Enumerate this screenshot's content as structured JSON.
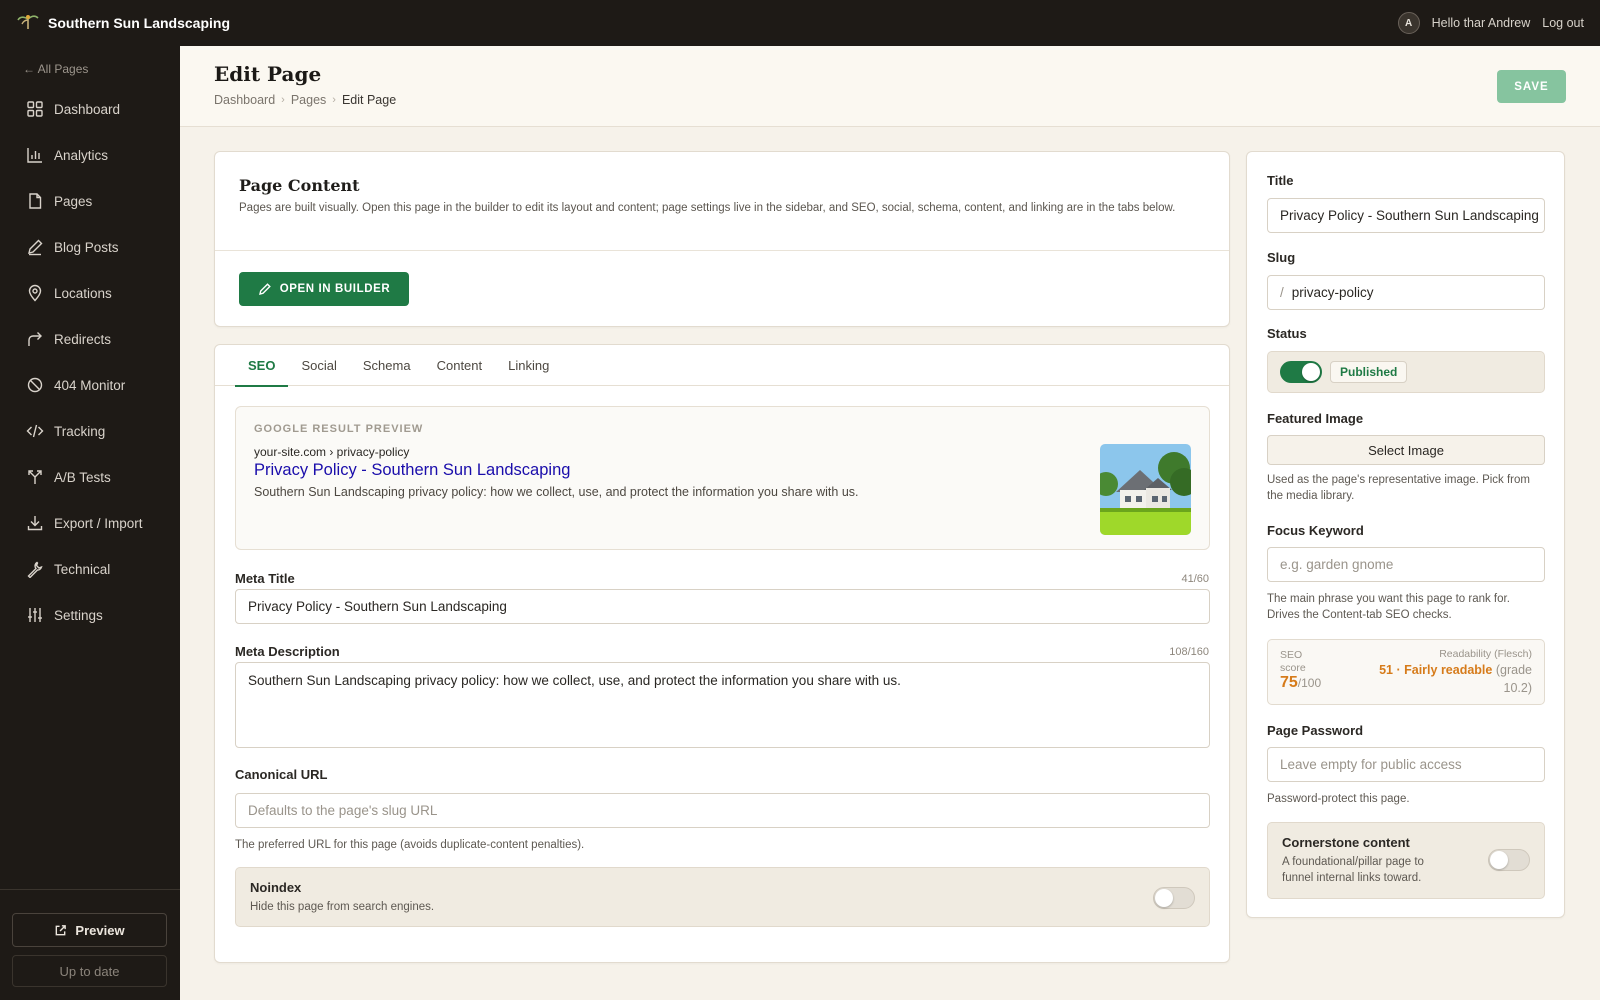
{
  "app": {
    "brand": "Southern Sun Landscaping"
  },
  "user": {
    "initial": "A",
    "greeting": "Hello thar Andrew",
    "logout": "Log out"
  },
  "sidebar": {
    "back": "← All Pages",
    "items": [
      {
        "label": "Dashboard",
        "icon": "grid-icon"
      },
      {
        "label": "Analytics",
        "icon": "bar-chart-icon"
      },
      {
        "label": "Pages",
        "icon": "file-icon"
      },
      {
        "label": "Blog Posts",
        "icon": "pen-icon"
      },
      {
        "label": "Locations",
        "icon": "map-pin-icon"
      },
      {
        "label": "Redirects",
        "icon": "redirect-arrow-icon"
      },
      {
        "label": "404 Monitor",
        "icon": "ban-icon"
      },
      {
        "label": "Tracking",
        "icon": "code-icon"
      },
      {
        "label": "A/B Tests",
        "icon": "split-icon"
      },
      {
        "label": "Export / Import",
        "icon": "download-icon"
      },
      {
        "label": "Technical",
        "icon": "wrench-icon"
      },
      {
        "label": "Settings",
        "icon": "sliders-icon"
      }
    ],
    "preview": "Preview",
    "up_to_date": "Up to date"
  },
  "header": {
    "title": "Edit Page",
    "breadcrumb": [
      "Dashboard",
      "Pages",
      "Edit Page"
    ],
    "save": "SAVE"
  },
  "content_card": {
    "title": "Page Content",
    "description": "Pages are built visually. Open this page in the builder to edit its layout and content; page settings live in the sidebar, and SEO, social, schema, content, and linking are in the tabs below.",
    "builder_button": "OPEN IN BUILDER"
  },
  "tabs": [
    "SEO",
    "Social",
    "Schema",
    "Content",
    "Linking"
  ],
  "google_preview": {
    "label": "GOOGLE RESULT PREVIEW",
    "url": "your-site.com › privacy-policy",
    "title": "Privacy Policy - Southern Sun Landscaping",
    "description": "Southern Sun Landscaping privacy policy: how we collect, use, and protect the information you share with us."
  },
  "seo": {
    "meta_title_label": "Meta Title",
    "meta_title_count": "41/60",
    "meta_title_value": "Privacy Policy - Southern Sun Landscaping",
    "meta_desc_label": "Meta Description",
    "meta_desc_count": "108/160",
    "meta_desc_value": "Southern Sun Landscaping privacy policy: how we collect, use, and protect the information you share with us.",
    "canonical_label": "Canonical URL",
    "canonical_placeholder": "Defaults to the page's slug URL",
    "canonical_help": "The preferred URL for this page (avoids duplicate-content penalties).",
    "noindex_title": "Noindex",
    "noindex_help": "Hide this page from search engines.",
    "noindex_on": false
  },
  "side": {
    "title_label": "Title",
    "title_value": "Privacy Policy - Southern Sun Landscaping",
    "slug_label": "Slug",
    "slug_prefix": "/",
    "slug_value": "privacy-policy",
    "status_label": "Status",
    "status_value": "Published",
    "status_on": true,
    "featured_label": "Featured Image",
    "select_image": "Select Image",
    "featured_help": "Used as the page's representative image. Pick from the media library.",
    "focus_label": "Focus Keyword",
    "focus_placeholder": "e.g. garden gnome",
    "focus_help": "The main phrase you want this page to rank for. Drives the Content-tab SEO checks.",
    "seo_score_label_1": "SEO",
    "seo_score_label_2": "score",
    "seo_score": "75",
    "seo_score_max": "/100",
    "readability_label": "Readability (Flesch)",
    "readability_value": "51 · Fairly readable",
    "readability_grade_1": "(grade",
    "readability_grade_2": "10.2)",
    "password_label": "Page Password",
    "password_placeholder": "Leave empty for public access",
    "password_help": "Password-protect this page.",
    "cornerstone_title": "Cornerstone content",
    "cornerstone_help": "A foundational/pillar page to funnel internal links toward.",
    "cornerstone_on": false
  },
  "colors": {
    "accent": "#1f7a45",
    "save": "#86c49f",
    "score": "#d67b1a",
    "link": "#1a0dab",
    "dark": "#1e1a16"
  }
}
